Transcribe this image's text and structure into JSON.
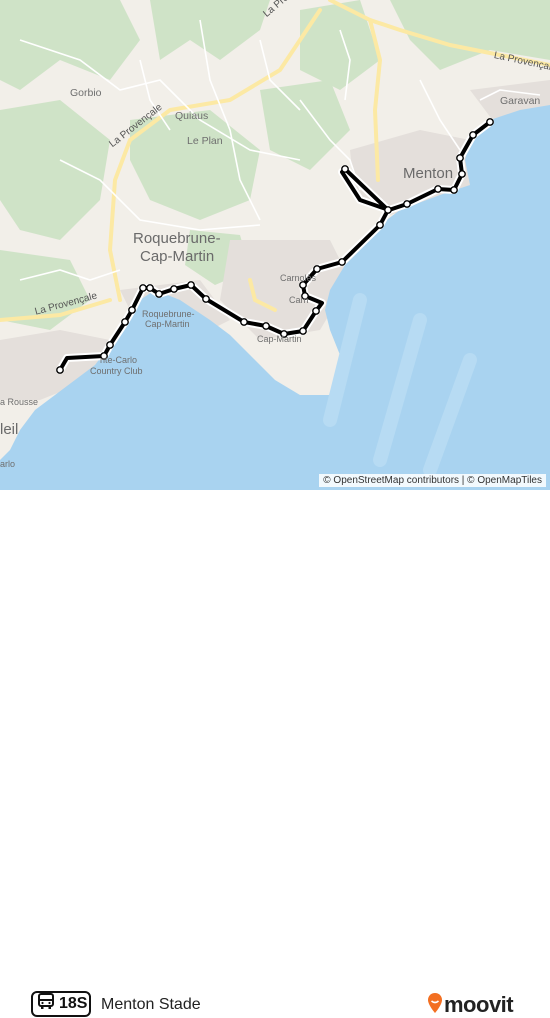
{
  "route": {
    "number": "18S",
    "destination": "Menton Stade",
    "route_color": "#000000",
    "stop_color": "#ffffff"
  },
  "brand": {
    "name": "moovit",
    "accent": "#f36f21"
  },
  "map": {
    "attribution": "© OpenStreetMap contributors | © OpenMapTiles",
    "colors": {
      "land": "#f2efe9",
      "forest": "#cfe3c7",
      "sea": "#a9d3f0",
      "urban": "#e6e2de",
      "road_major": "#fce9a4",
      "road_minor": "#ffffff"
    },
    "labels": {
      "menton": "Menton",
      "roquebrune_1": "Roquebrune-",
      "roquebrune_2": "Cap-Martin",
      "gorbio": "Gorbio",
      "quiaus": "Quiaus",
      "le_plan": "Le Plan",
      "garavan": "Garavan",
      "carnoles": "Carnolès",
      "carnoles_short": "Carn",
      "cap_martin": "Cap-Martin",
      "cap_martin_small_1": "Roquebrune-",
      "cap_martin_small_2": "Cap-Martin",
      "country_club_1": "nte-Carlo",
      "country_club_2": "Country Club",
      "la_rousse": "a Rousse",
      "soleil": "leil",
      "carlo": "arlo",
      "road_provencale_top": "La Provençale",
      "road_provencale_left": "La Provençale",
      "road_provencale_right": "La Provençale",
      "road_provencale_bottom": "La Provençale"
    }
  },
  "icons": {
    "bus": "bus-icon",
    "moovit_pin": "moovit-pin-icon"
  }
}
